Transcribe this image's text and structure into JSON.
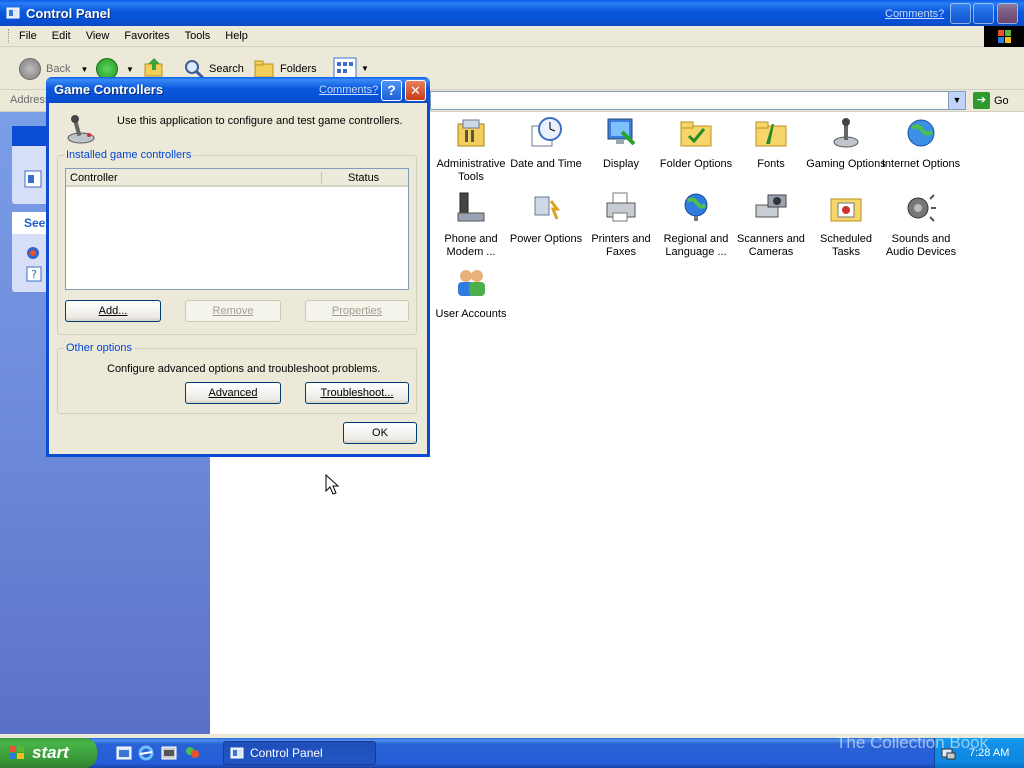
{
  "window": {
    "title": "Control Panel",
    "comments_link": "Comments?",
    "menu": [
      "File",
      "Edit",
      "View",
      "Favorites",
      "Tools",
      "Help"
    ]
  },
  "toolbar": {
    "back": "Back",
    "search": "Search",
    "folders": "Folders"
  },
  "addressbar": {
    "label": "Address",
    "go": "Go"
  },
  "left_pane": {
    "see_also_header": "See"
  },
  "control_panel_items": [
    {
      "label": "Administrative Tools",
      "icon": "admin-tools-icon"
    },
    {
      "label": "Date and Time",
      "icon": "date-time-icon"
    },
    {
      "label": "Display",
      "icon": "display-icon"
    },
    {
      "label": "Folder Options",
      "icon": "folder-options-icon"
    },
    {
      "label": "Fonts",
      "icon": "fonts-icon"
    },
    {
      "label": "Gaming Options",
      "icon": "gaming-options-icon"
    },
    {
      "label": "Internet Options",
      "icon": "internet-options-icon"
    },
    {
      "label": "Phone and Modem ...",
      "icon": "phone-modem-icon"
    },
    {
      "label": "Power Options",
      "icon": "power-options-icon"
    },
    {
      "label": "Printers and Faxes",
      "icon": "printers-faxes-icon"
    },
    {
      "label": "Regional and Language ...",
      "icon": "regional-language-icon"
    },
    {
      "label": "Scanners and Cameras",
      "icon": "scanners-cameras-icon"
    },
    {
      "label": "Scheduled Tasks",
      "icon": "scheduled-tasks-icon"
    },
    {
      "label": "Sounds and Audio Devices",
      "icon": "sounds-audio-icon"
    },
    {
      "label": "User Accounts",
      "icon": "user-accounts-icon"
    }
  ],
  "dialog": {
    "title": "Game Controllers",
    "comments_link": "Comments?",
    "help_glyph": "?",
    "intro": "Use this application to configure and test game controllers.",
    "installed_group": "Installed game controllers",
    "columns": [
      "Controller",
      "Status"
    ],
    "buttons": {
      "add": "Add...",
      "remove": "Remove",
      "properties": "Properties",
      "advanced": "Advanced",
      "troubleshoot": "Troubleshoot...",
      "ok": "OK"
    },
    "other_group": "Other options",
    "other_desc": "Configure advanced options and troubleshoot problems."
  },
  "taskbar": {
    "start": "start",
    "task": "Control Panel",
    "clock": "7:28 AM",
    "watermark": "The Collection Book"
  },
  "colors": {
    "xp_blue": "#0a58dc",
    "start_green": "#3a9a3a",
    "link_blue": "#0046d5"
  }
}
